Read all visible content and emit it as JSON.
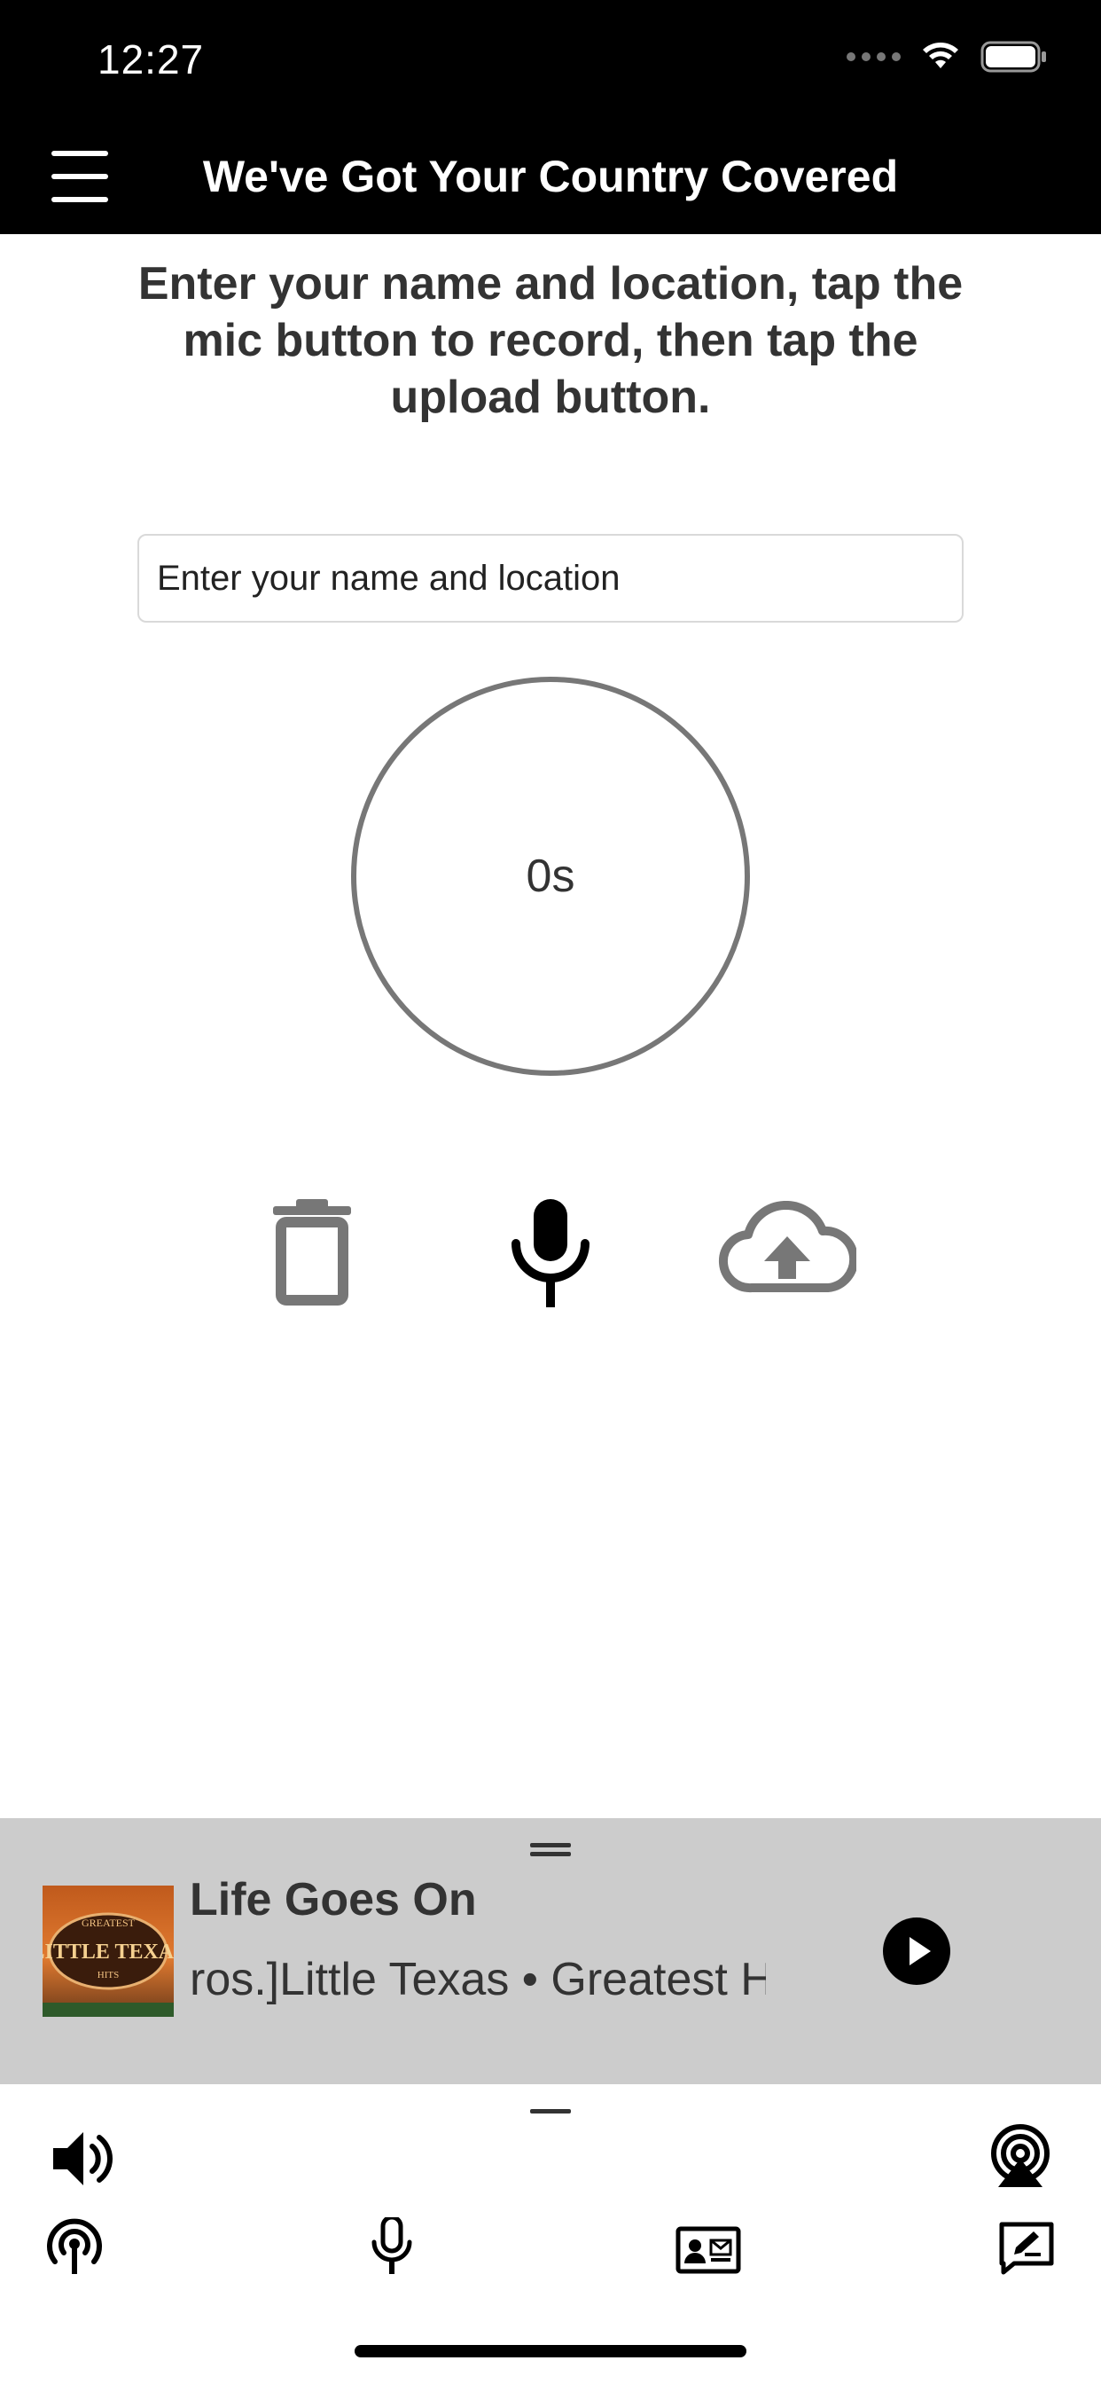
{
  "status_bar": {
    "time": "12:27"
  },
  "header": {
    "title": "We've Got Your Country Covered"
  },
  "instructions": "Enter your name and location, tap the mic button to record, then tap the upload button.",
  "name_input": {
    "placeholder": "Enter your name and location",
    "value": ""
  },
  "timer": {
    "label": "0s"
  },
  "actions": {
    "delete_icon": "trash-icon",
    "record_icon": "mic-icon",
    "upload_icon": "cloud-upload-icon"
  },
  "now_playing": {
    "title": "Life Goes On",
    "subtitle": "ros.]Little Texas • Greatest H",
    "album_art": {
      "text_top": "GREATEST",
      "text_main": "LITTLE TEXAS",
      "text_bottom": "HITS"
    },
    "play_icon": "play-icon"
  },
  "toolbar": {
    "icons": [
      "volume-icon",
      "airplay-icon",
      "podcast-icon",
      "mic-icon",
      "contact-card-icon",
      "message-edit-icon"
    ]
  },
  "colors": {
    "header_bg": "#000000",
    "panel_bg": "#cccccc",
    "text": "#333333",
    "icon_gray": "#777777"
  }
}
